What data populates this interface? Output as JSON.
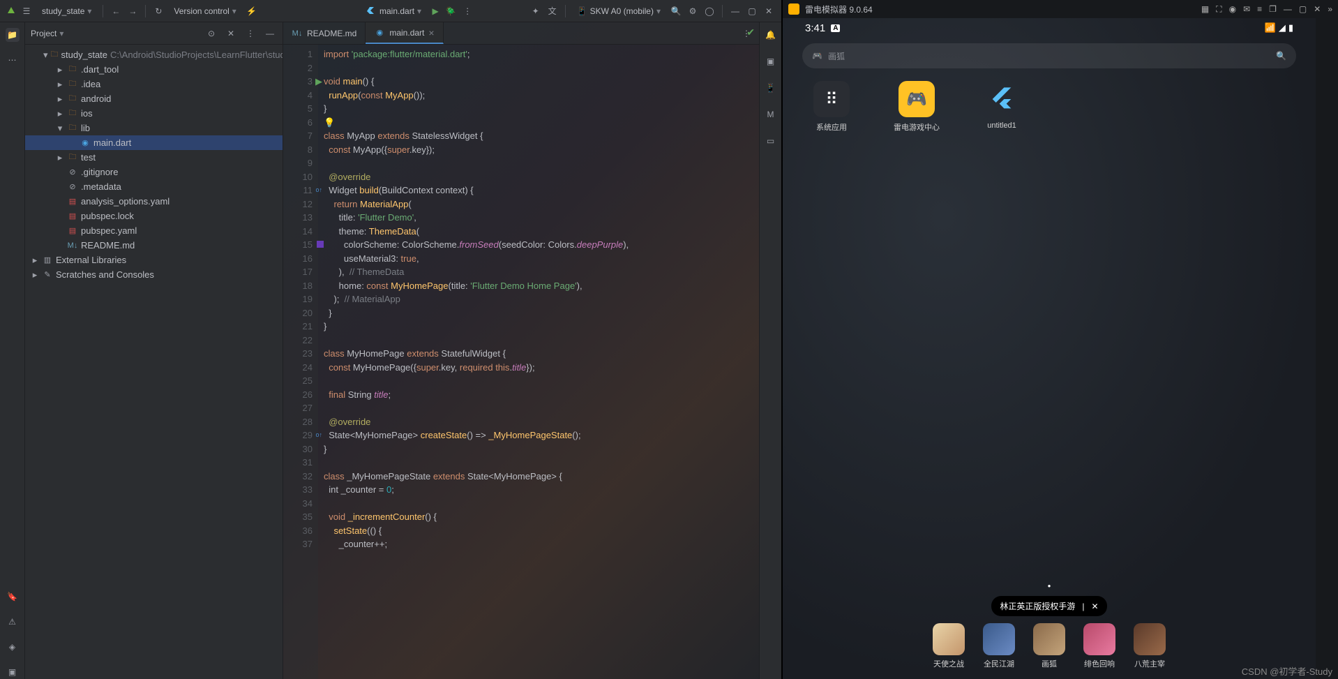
{
  "topbar": {
    "project": "study_state",
    "vcs": "Version control",
    "run_config": "main.dart",
    "device": "SKW A0 (mobile)"
  },
  "project_panel": {
    "title": "Project",
    "root": "study_state",
    "root_path": "C:\\Android\\StudioProjects\\LearnFlutter\\study_state",
    "items": [
      {
        "d": 1,
        "exp": "▾",
        "icon": "folder",
        "name": "study_state",
        "extra": "path"
      },
      {
        "d": 2,
        "exp": "▸",
        "icon": "folder",
        "name": ".dart_tool"
      },
      {
        "d": 2,
        "exp": "▸",
        "icon": "folder",
        "name": ".idea"
      },
      {
        "d": 2,
        "exp": "▸",
        "icon": "folder",
        "name": "android"
      },
      {
        "d": 2,
        "exp": "▸",
        "icon": "folder",
        "name": "ios"
      },
      {
        "d": 2,
        "exp": "▾",
        "icon": "folder",
        "name": "lib"
      },
      {
        "d": 3,
        "exp": "",
        "icon": "dart",
        "name": "main.dart",
        "sel": true
      },
      {
        "d": 2,
        "exp": "▸",
        "icon": "folder",
        "name": "test"
      },
      {
        "d": 2,
        "exp": "",
        "icon": "txt",
        "name": ".gitignore"
      },
      {
        "d": 2,
        "exp": "",
        "icon": "txt",
        "name": ".metadata"
      },
      {
        "d": 2,
        "exp": "",
        "icon": "yaml",
        "name": "analysis_options.yaml"
      },
      {
        "d": 2,
        "exp": "",
        "icon": "yaml",
        "name": "pubspec.lock"
      },
      {
        "d": 2,
        "exp": "",
        "icon": "yaml",
        "name": "pubspec.yaml"
      },
      {
        "d": 2,
        "exp": "",
        "icon": "md",
        "name": "README.md"
      },
      {
        "d": 0,
        "exp": "▸",
        "icon": "lib",
        "name": "External Libraries"
      },
      {
        "d": 0,
        "exp": "▸",
        "icon": "scratch",
        "name": "Scratches and Consoles"
      }
    ]
  },
  "tabs": [
    {
      "icon": "md",
      "label": "README.md",
      "active": false
    },
    {
      "icon": "dart",
      "label": "main.dart",
      "active": true
    }
  ],
  "code": [
    {
      "n": 1,
      "html": "<span class='kw'>import</span> <span class='str'>'package:flutter/material.dart'</span>;"
    },
    {
      "n": 2,
      "html": ""
    },
    {
      "n": 3,
      "html": "<span class='kw'>void</span> <span class='fn'>main</span>() {",
      "mark": "run"
    },
    {
      "n": 4,
      "html": "  <span class='fn'>runApp</span>(<span class='kw'>const</span> <span class='fn'>MyApp</span>());"
    },
    {
      "n": 5,
      "html": "}"
    },
    {
      "n": 6,
      "html": "",
      "bulb": true
    },
    {
      "n": 7,
      "html": "<span class='kw'>class</span> <span class='cls'>MyApp</span> <span class='kw'>extends</span> <span class='cls'>StatelessWidget</span> {"
    },
    {
      "n": 8,
      "html": "  <span class='kw'>const</span> MyApp({<span class='kw'>super</span>.key});"
    },
    {
      "n": 9,
      "html": ""
    },
    {
      "n": 10,
      "html": "  <span class='ann'>@override</span>"
    },
    {
      "n": 11,
      "html": "  Widget <span class='fn'>build</span>(BuildContext context) {",
      "mark": "override"
    },
    {
      "n": 12,
      "html": "    <span class='kw'>return</span> <span class='fn'>MaterialApp</span>("
    },
    {
      "n": 13,
      "html": "      title: <span class='str'>'Flutter Demo'</span>,"
    },
    {
      "n": 14,
      "html": "      theme: <span class='fn'>ThemeData</span>("
    },
    {
      "n": 15,
      "html": "        colorScheme: <span class='cls'>ColorScheme</span>.<span class='id'>fromSeed</span>(seedColor: Colors.<span class='id'>deepPurple</span>),",
      "mark": "color"
    },
    {
      "n": 16,
      "html": "        useMaterial3: <span class='kw'>true</span>,"
    },
    {
      "n": 17,
      "html": "      ),  <span class='com'>// ThemeData</span>"
    },
    {
      "n": 18,
      "html": "      home: <span class='kw'>const</span> <span class='fn'>MyHomePage</span>(title: <span class='str'>'Flutter Demo Home Page'</span>),"
    },
    {
      "n": 19,
      "html": "    );  <span class='com'>// MaterialApp</span>"
    },
    {
      "n": 20,
      "html": "  }"
    },
    {
      "n": 21,
      "html": "}"
    },
    {
      "n": 22,
      "html": ""
    },
    {
      "n": 23,
      "html": "<span class='kw'>class</span> <span class='cls'>MyHomePage</span> <span class='kw'>extends</span> <span class='cls'>StatefulWidget</span> {"
    },
    {
      "n": 24,
      "html": "  <span class='kw'>const</span> MyHomePage({<span class='kw'>super</span>.key, <span class='kw'>required this</span>.<span class='id'>title</span>});"
    },
    {
      "n": 25,
      "html": ""
    },
    {
      "n": 26,
      "html": "  <span class='kw'>final</span> String <span class='id'>title</span>;"
    },
    {
      "n": 27,
      "html": ""
    },
    {
      "n": 28,
      "html": "  <span class='ann'>@override</span>"
    },
    {
      "n": 29,
      "html": "  State&lt;MyHomePage&gt; <span class='fn'>createState</span>() =&gt; <span class='fn'>_MyHomePageState</span>();",
      "mark": "override"
    },
    {
      "n": 30,
      "html": "}"
    },
    {
      "n": 31,
      "html": ""
    },
    {
      "n": 32,
      "html": "<span class='kw'>class</span> <span class='cls'>_MyHomePageState</span> <span class='kw'>extends</span> State&lt;MyHomePage&gt; {"
    },
    {
      "n": 33,
      "html": "  int _counter = <span class='num'>0</span>;"
    },
    {
      "n": 34,
      "html": ""
    },
    {
      "n": 35,
      "html": "  <span class='kw'>void</span> <span class='fn'>_incrementCounter</span>() {"
    },
    {
      "n": 36,
      "html": "    <span class='fn'>setState</span>(() {"
    },
    {
      "n": 37,
      "html": "      _counter++;"
    }
  ],
  "emulator": {
    "title": "雷电模拟器 9.0.64",
    "clock": "3:41",
    "search_placeholder": "画狐",
    "apps": [
      {
        "label": "系统应用",
        "bg": "#2a2d33",
        "glyph": "⠿"
      },
      {
        "label": "雷电游戏中心",
        "bg": "#ffc225",
        "glyph": "🎮"
      },
      {
        "label": "untitled1",
        "bg": "transparent",
        "glyph": "flutter"
      }
    ],
    "tooltip": "林正英正版授权手游",
    "dock": [
      {
        "label": "天使之战"
      },
      {
        "label": "全民江湖"
      },
      {
        "label": "画狐"
      },
      {
        "label": "绯色回响"
      },
      {
        "label": "八荒主宰"
      }
    ]
  },
  "watermark": "CSDN @初学者-Study"
}
